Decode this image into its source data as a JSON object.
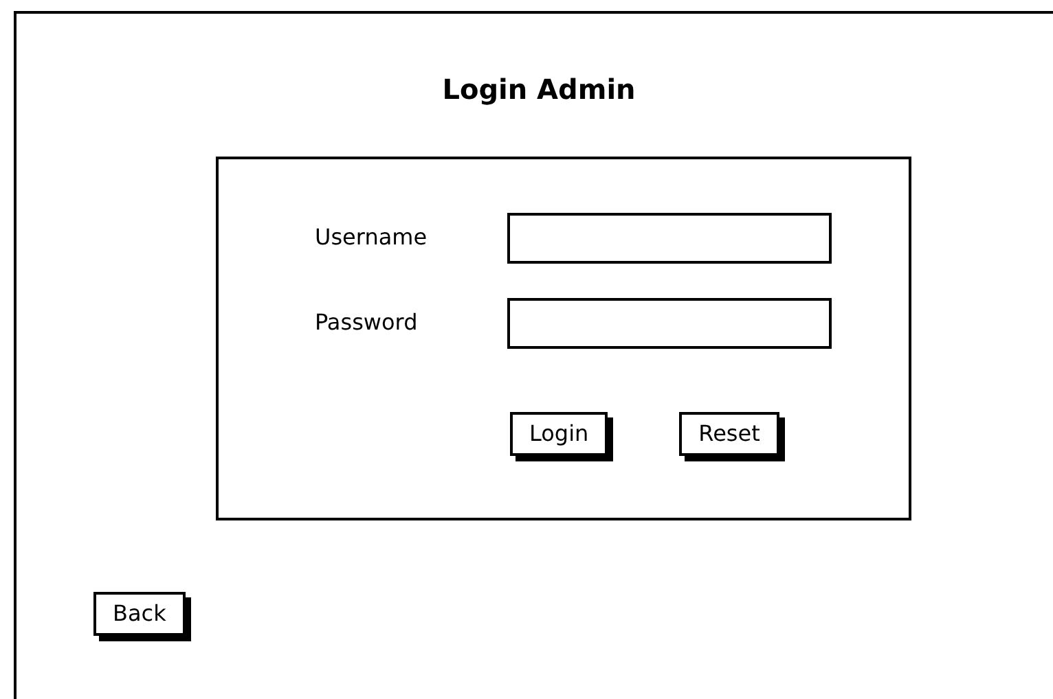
{
  "title": "Login Admin",
  "fields": [
    {
      "label": "Username"
    },
    {
      "label": "Password"
    }
  ],
  "buttons": [
    "Login",
    "Reset"
  ],
  "back_button": "Back"
}
